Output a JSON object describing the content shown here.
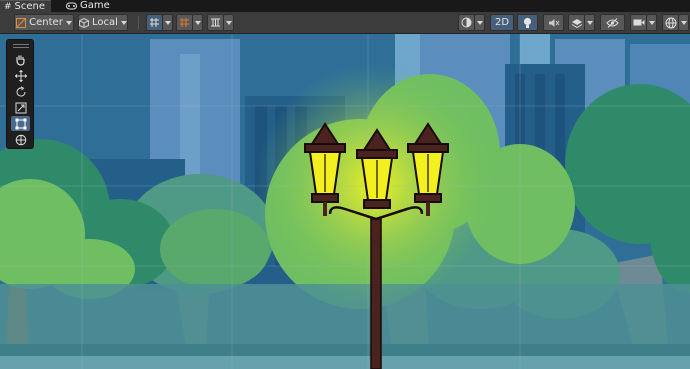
{
  "tabs": [
    {
      "label": "Scene",
      "icon": "hash-icon",
      "active": true
    },
    {
      "label": "Game",
      "icon": "gamepad-icon",
      "active": false
    }
  ],
  "toolbar": {
    "pivot_label": "Center",
    "space_label": "Local",
    "mode_2d_label": "2D",
    "mode_2d_active": true
  },
  "tools": [
    "hand-tool",
    "move-tool",
    "rotate-tool",
    "scale-tool",
    "rect-tool",
    "transform-tool"
  ],
  "selected_tool": "rect-tool",
  "colors": {
    "accent": "#46607c",
    "sky": "#2f6f97",
    "lamp_glow": "#f2f01e",
    "lamp_post": "#4a2320"
  }
}
